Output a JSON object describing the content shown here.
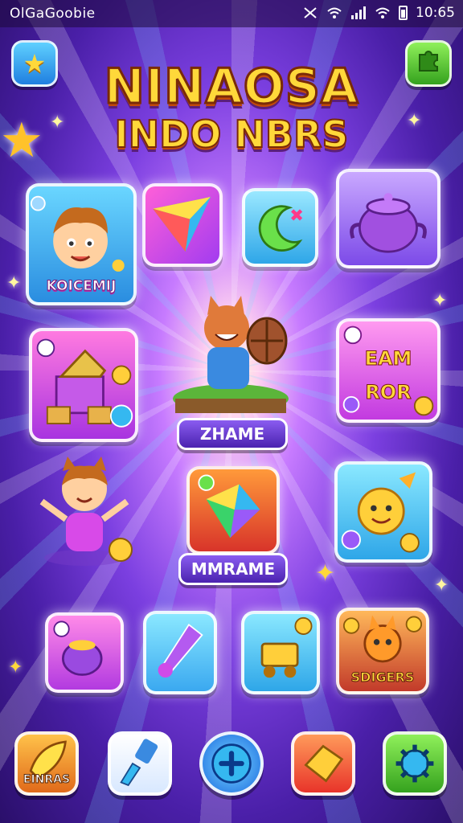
{
  "status_bar": {
    "carrier": "OlGaGoobie",
    "time": "10:65",
    "icons": [
      "mute-icon",
      "wifi-icon",
      "signal-icon",
      "wifi-icon",
      "battery-icon"
    ]
  },
  "header": {
    "left_button_icon": "star-icon",
    "right_button_icon": "puzzle-icon",
    "title_line1": "NINAOSA",
    "title_line2": "INDO NBRS"
  },
  "tiles": {
    "row1": [
      {
        "icon": "boy-character",
        "label": "KOICEMIJ"
      },
      {
        "icon": "rainbow-gem",
        "label": ""
      },
      {
        "icon": "moon-icon",
        "label": ""
      },
      {
        "icon": "purple-pot",
        "label": ""
      }
    ],
    "row2_left": {
      "icon": "castle-blocks",
      "label": ""
    },
    "center_featured": {
      "icon": "cat-character-with-drum",
      "label": "ZHAME"
    },
    "row2_right": {
      "icon": "letters-board",
      "label_top": "EAM",
      "label_bottom": "ROR"
    },
    "row3_left": {
      "icon": "girl-character",
      "label": ""
    },
    "center_second": {
      "icon": "rainbow-gem",
      "label": "MMRAME"
    },
    "row3_right": {
      "icon": "sun-character",
      "label": ""
    },
    "row4": [
      {
        "icon": "purple-cauldron",
        "label": ""
      },
      {
        "icon": "crystal-wand",
        "label": ""
      },
      {
        "icon": "golden-cart",
        "label": ""
      },
      {
        "icon": "orange-creature",
        "label": "SDIGERS"
      }
    ]
  },
  "bottom_nav": [
    {
      "icon": "rocket-icon",
      "label": "EINRAS"
    },
    {
      "icon": "paintbrush-icon",
      "label": ""
    },
    {
      "icon": "plus-icon",
      "label": ""
    },
    {
      "icon": "gem-icon",
      "label": ""
    },
    {
      "icon": "gear-icon",
      "label": ""
    }
  ],
  "colors": {
    "title_gold": "#ffd83a",
    "background_purple": "#4a1fa8",
    "accent_green": "#5fd43a",
    "accent_blue": "#35b8f0"
  }
}
